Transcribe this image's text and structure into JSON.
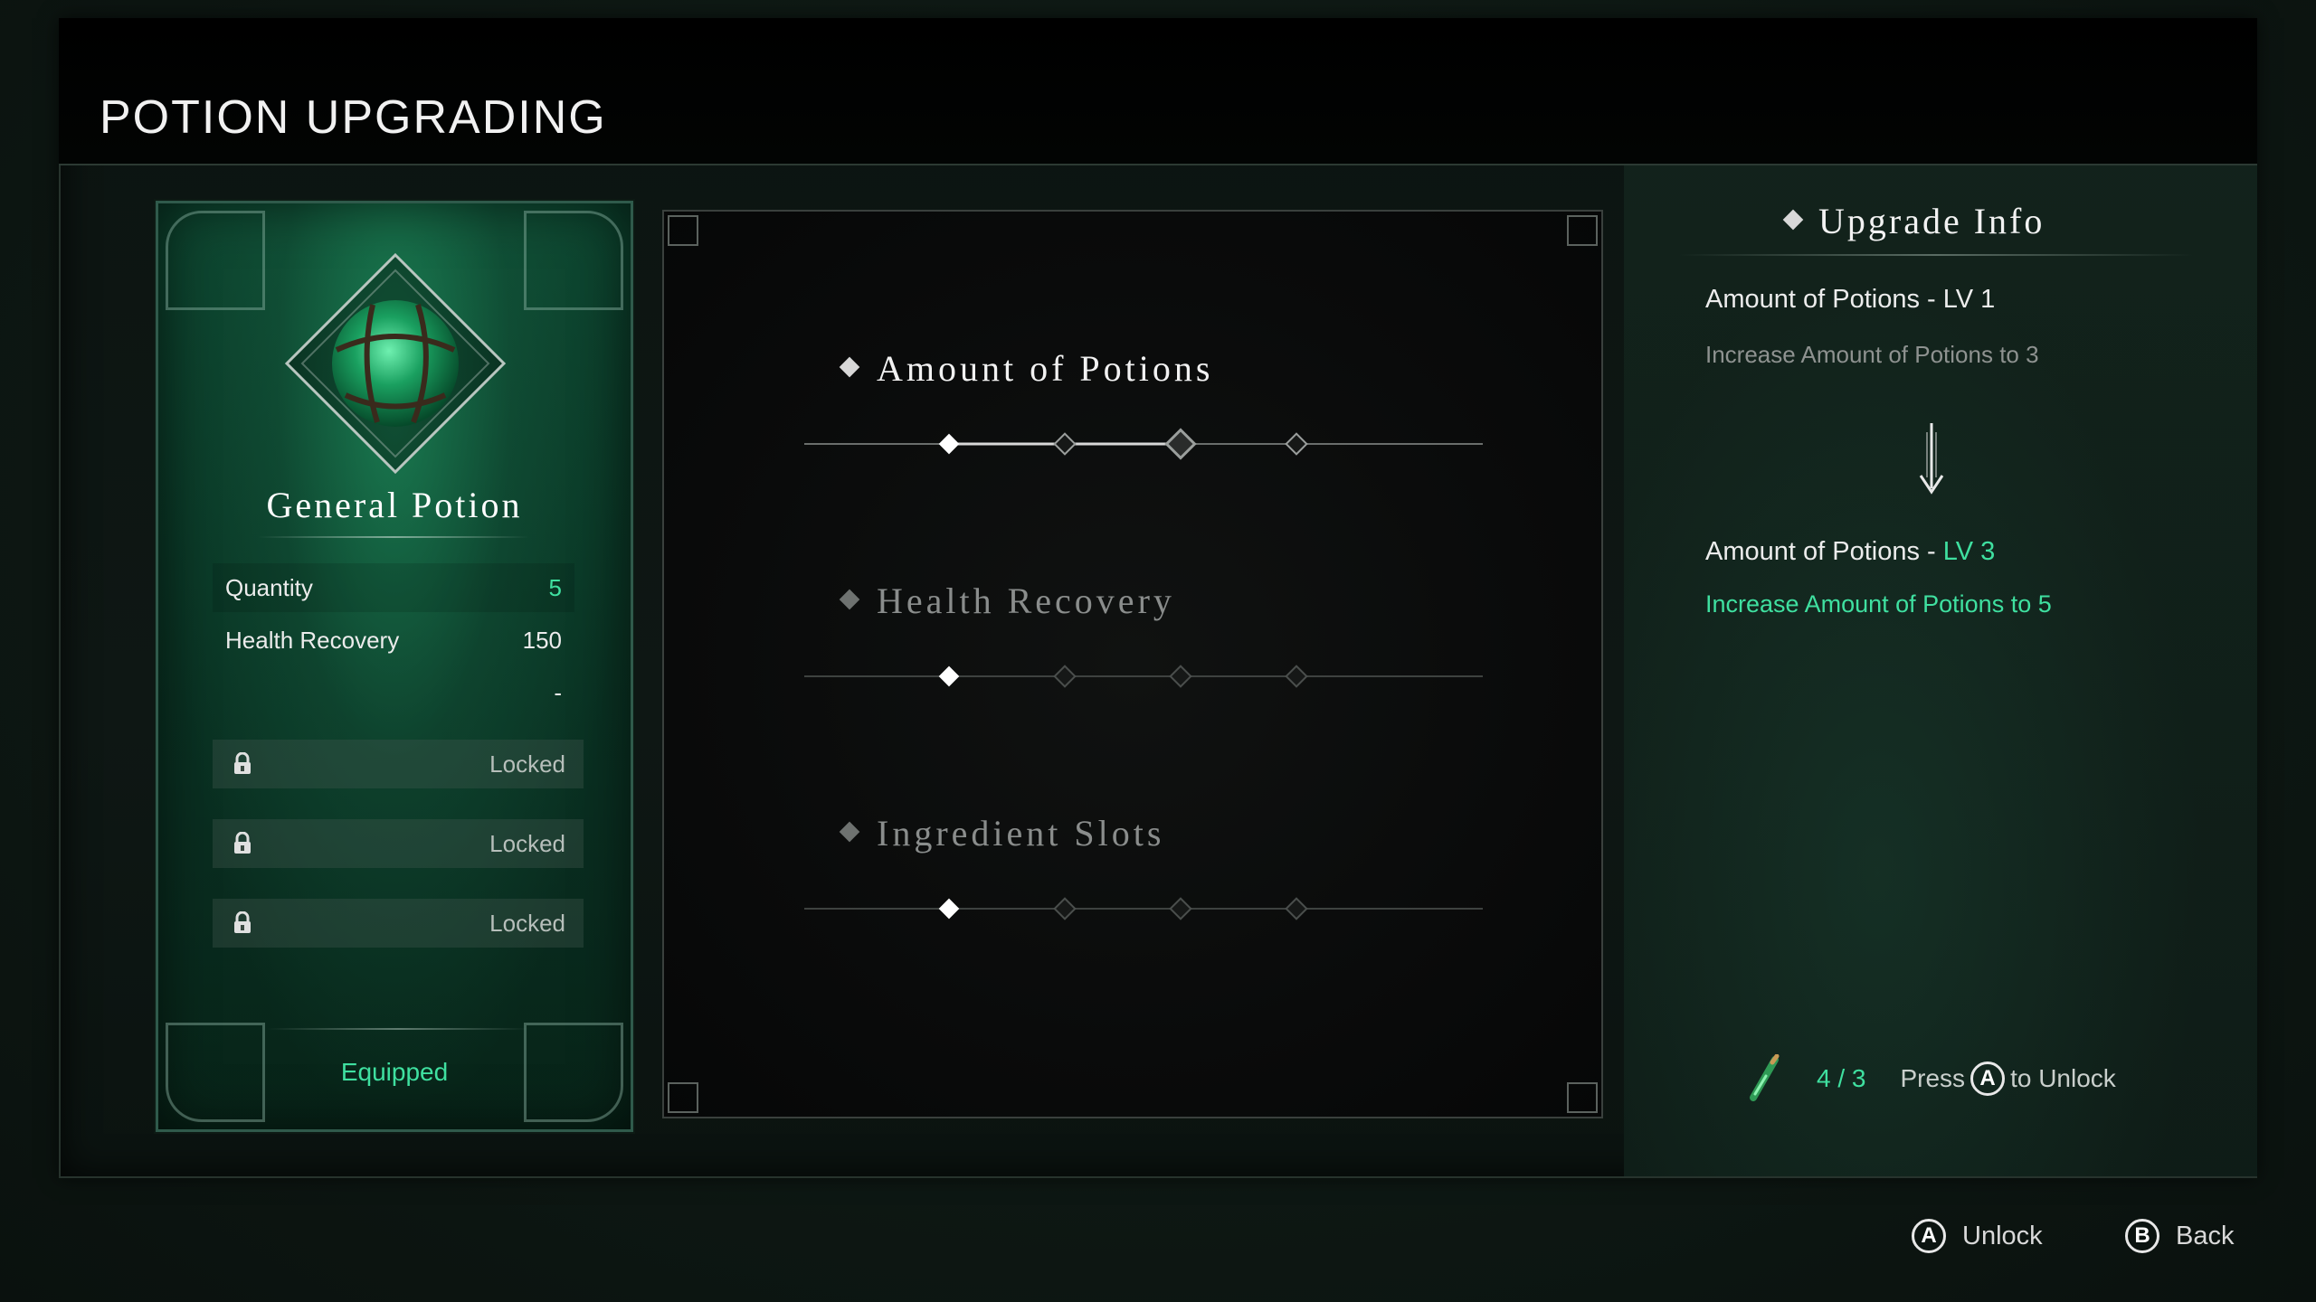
{
  "header": {
    "title": "POTION UPGRADING"
  },
  "card": {
    "potion_name": "General Potion",
    "stats": [
      {
        "label": "Quantity",
        "value": "5"
      },
      {
        "label": "Health Recovery",
        "value": "150"
      },
      {
        "label": "",
        "value": "-"
      }
    ],
    "slots": [
      {
        "status": "Locked"
      },
      {
        "status": "Locked"
      },
      {
        "status": "Locked"
      }
    ],
    "equipped_label": "Equipped"
  },
  "upgrades": [
    {
      "label": "Amount of Potions",
      "level": 1,
      "max_level": 4,
      "active": true
    },
    {
      "label": "Health Recovery",
      "level": 1,
      "max_level": 4,
      "active": false
    },
    {
      "label": "Ingredient Slots",
      "level": 1,
      "max_level": 4,
      "active": false
    }
  ],
  "info": {
    "title": "Upgrade Info",
    "current_name": "Amount of Potions - ",
    "current_level": "LV 1",
    "current_desc": "Increase Amount of Potions to 3",
    "next_name": "Amount of Potions - ",
    "next_level": "LV 3",
    "next_desc": "Increase Amount of Potions to 5",
    "cost": "4 / 3",
    "press_label": "Press",
    "press_button": "A",
    "unlock_label": "to Unlock"
  },
  "footer": {
    "unlock": {
      "button": "A",
      "label": "Unlock"
    },
    "back": {
      "button": "B",
      "label": "Back"
    }
  },
  "colors": {
    "accent_green": "#3fe0a0",
    "text_primary": "#e6e6e6",
    "text_dim": "#8e9290"
  },
  "icons": {
    "potion": "potion-orb-icon",
    "lock": "lock-icon",
    "arrow": "arrow-down-icon",
    "cost": "potion-vial-icon"
  }
}
